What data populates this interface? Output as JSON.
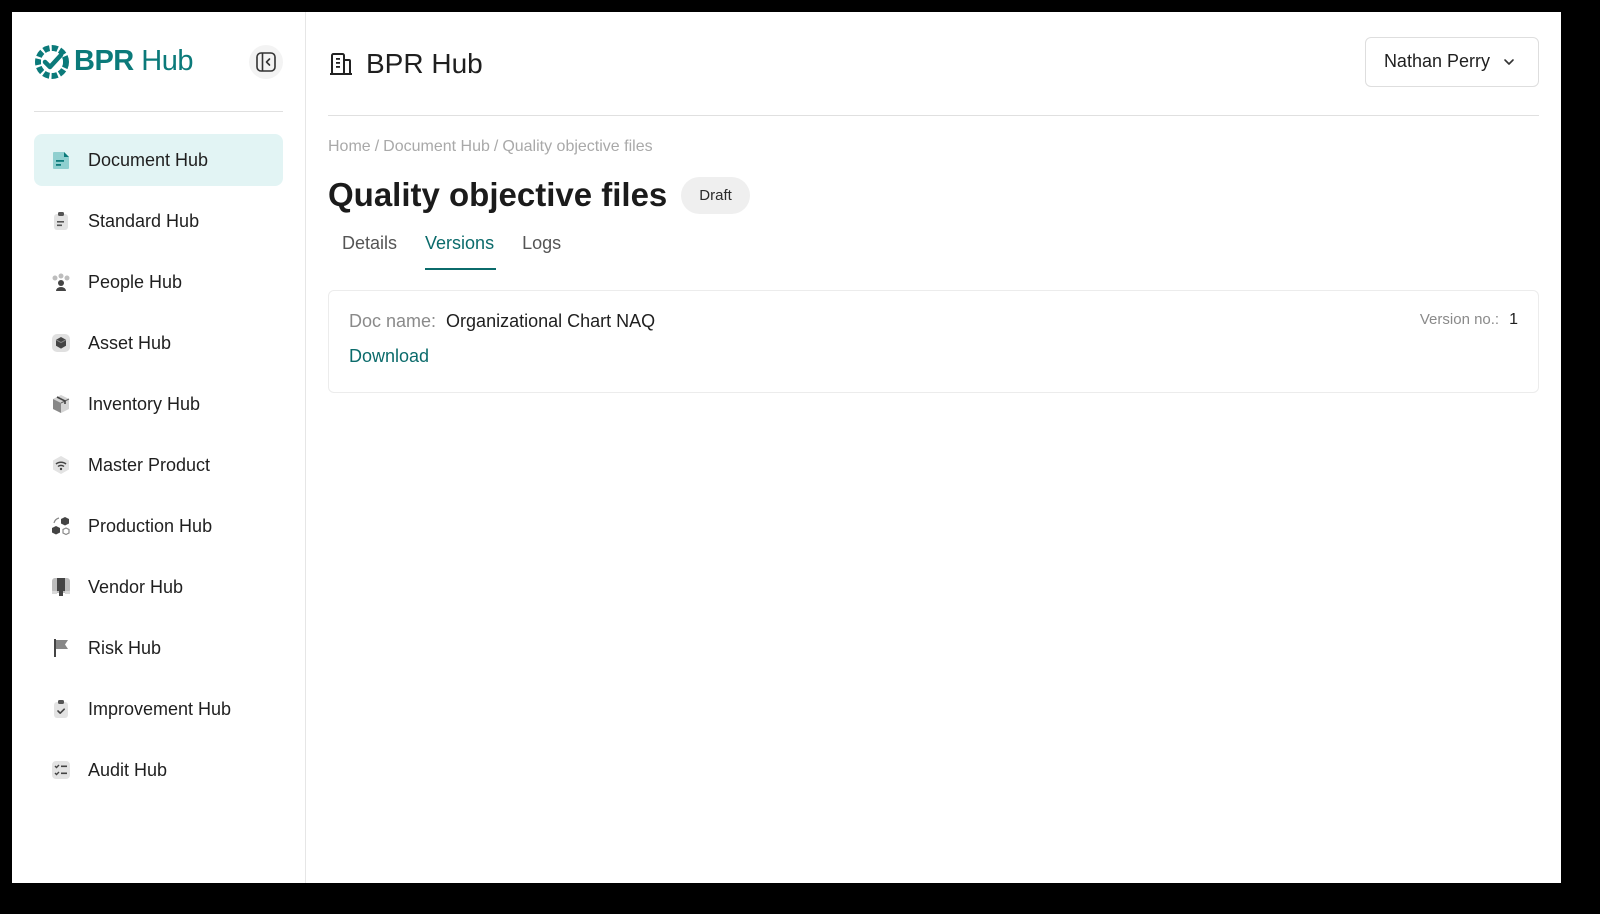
{
  "brand": {
    "name_bold": "BPR",
    "name_light": " Hub",
    "color": "#0b7a7a"
  },
  "sidebar": {
    "items": [
      {
        "label": "Document Hub",
        "icon": "document-icon",
        "active": true
      },
      {
        "label": "Standard Hub",
        "icon": "clipboard-icon"
      },
      {
        "label": "People Hub",
        "icon": "people-icon"
      },
      {
        "label": "Asset Hub",
        "icon": "asset-icon"
      },
      {
        "label": "Inventory Hub",
        "icon": "box-icon"
      },
      {
        "label": "Master Product",
        "icon": "signal-icon"
      },
      {
        "label": "Production Hub",
        "icon": "production-icon"
      },
      {
        "label": "Vendor Hub",
        "icon": "vendor-icon"
      },
      {
        "label": "Risk Hub",
        "icon": "flag-icon"
      },
      {
        "label": "Improvement Hub",
        "icon": "clipboard-check-icon"
      },
      {
        "label": "Audit Hub",
        "icon": "checklist-icon"
      }
    ]
  },
  "header": {
    "title": "BPR Hub",
    "user": "Nathan Perry"
  },
  "breadcrumb": {
    "home": "Home",
    "sep1": "/",
    "section": "Document Hub",
    "sep2": "/",
    "current": "Quality objective files"
  },
  "page": {
    "title": "Quality objective files",
    "status": "Draft",
    "tabs": [
      {
        "label": "Details"
      },
      {
        "label": "Versions",
        "active": true
      },
      {
        "label": "Logs"
      }
    ]
  },
  "version": {
    "doc_label": "Doc name:",
    "doc_name": "Organizational Chart NAQ",
    "download_label": "Download",
    "version_label": "Version no.:",
    "version_value": "1"
  }
}
